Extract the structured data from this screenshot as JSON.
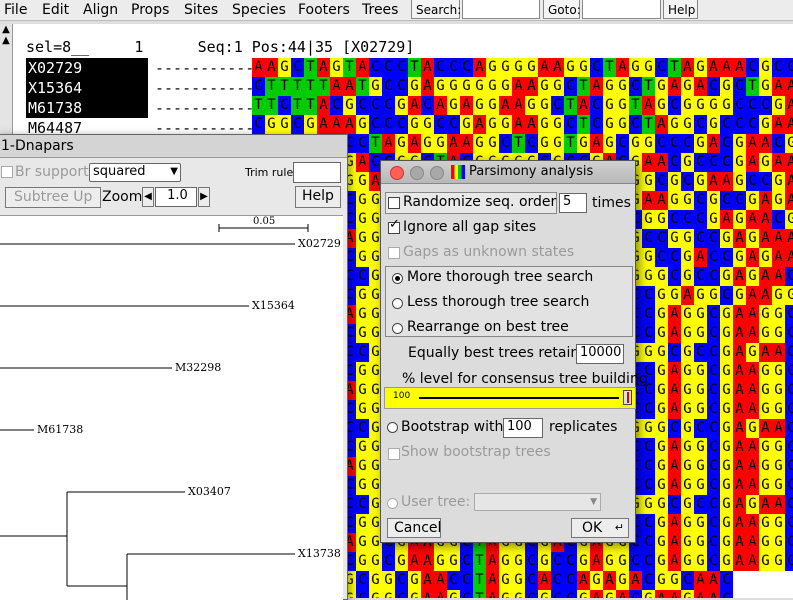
{
  "menubar": {
    "items": [
      "File",
      "Edit",
      "Align",
      "Props",
      "Sites",
      "Species",
      "Footers",
      "Trees"
    ],
    "search_label": "Search:",
    "goto_label": "Goto:",
    "help_label": "Help"
  },
  "alignment": {
    "status_line": "sel=8__     1      Seq:1 Pos:44|35 [X02729]",
    "sequence_names": [
      {
        "name": "X02729",
        "selected": true
      },
      {
        "name": "X15364",
        "selected": true
      },
      {
        "name": "M61738",
        "selected": true
      },
      {
        "name": "M64487",
        "selected": false
      }
    ],
    "gap_prefixes": [
      "-----------",
      "-------------",
      "---------------",
      "---------------"
    ],
    "rows": [
      "AAGCTAGTACCCTACCCAGGGGAAGGCTAGGCTAGAAACGCCGATGAAG",
      "CTTTTTAATGCCGAGGGGGGAAGGCTAGGCTGAGACGCTGAAGAAGCTA",
      "TTCTTACGCCCGACAGAGGAAGGCTACGGTAGCGGGGCCCGACGAACG",
      "CGGCGAAAGCCCGGCCGAGGAAGGCTCGGCTAGGCGCCCGAAAGAAGT",
      "GCTACTGCCTAGAGGAAGGCTCGGTGAGCGGCCCGACGAACGGCTTAC",
      "AAGCTACGACCGGCTACGGGGGCGCCGACGAACGCCCGAGAACGCCGA",
      "CGAGCTTGGAGGAAGGCGAAGGCTACCGAGGCGCGAAGCCGAGAACGGC",
      "CAAGCTACGGCGAAGGCTAGGCGCCGAAAGAAGGCGCCGAGAACGGACG",
      "AAGGCTACGGCGAAGGCTAGGCGCCGAGGCGGCCCGAGAACGAGGCGAA",
      "CGAGCTAAGGCGAAGGCTAGGGGCCCGAGGCCGGCCGAGAAAGGCTACG",
      "AAGGCTACGGCGAAGGCTAGGGCGGCCGAGGCCGACCGAGAACGAGGCC",
      "CGGCTAGCCGAAGGCTAGGCCCGACGAAGGGGCGCCGAGAACGGCGAAG",
      "AAGGCTACGGCGAAGGCTACCGCCGAGGACCGGAGGCGAAGGCAACGGG",
      "CGAGCTAAGGCGAAGGCTAGGCGCCGAGGCCGAGGCGAAGGCAACGGCC",
      "AAGGCTACGGCGAAGGCTAGGCGACGAGGCCGAGGCGAAGGCAACGGCT",
      "CGGCTAGCCGAAGGCTAGGCCCGACGAAGGGGCGCCGAGAACGGCGAAG",
      "AAGGCTACGGCGAAGGCTAGCGGCCGAGGCCGAGGCGAAGGCAACGGAA",
      "CGAGCTAAGGCGAAGGCTAGGCGACGAGGCCGAGGCGAAGGCAACGGCA",
      "AAGGCTACGGCGAAGGCTAGGCGCCGAGGCCGAGGCGAAGGCAACGGCG",
      "CGGCTAGCCGAAGGCTAGGCCCGACGAAGGGGCGCCGAGAACGGCGAAG",
      "AAGGCTACGGCGAAGGCTAGCGGCCGAGGCCGAGGCGAAGGCAACGGCA",
      "CGAGCTAAGGCGAAGGCTAGGCGACGAGGCCGAGGCGAAGGCAACGGCG",
      "AAGGCTACGGCGAAGGCTAGGCGCCGAGGCCGAGGCGAAGGCAACGGCA",
      "CGGCTAGCCGAAGGCTAGGCCCGACGAAGGGGCGCCGAGAACGGCGAAG",
      "AAGGCTACGGCGAAGGCTAGCGGCCGAGGCCGAGGCGAAGGCAACGGCG",
      "CGAGCTAAGGCGAAGGCTAGGCGACGAGGCCGAGGCGAAGGCAACGGCA",
      "AAGGCTACGGCGAAGGCTAGGCGCCGAGGCCGAGGCGAAGGCAACGGCG",
      "AAGGCTTGCGGCGAACCTAGGCACCAGAGACGGCAAC",
      "AAGGCTTGCGGCGAAGCTAGGCGCCGAGACGAAGAAC"
    ]
  },
  "tree_window": {
    "title": "1-Dnapars",
    "br_support_label": "Br support",
    "scale_select": "squared",
    "trim_rule_label": "Trim rule:",
    "subtree_up_label": "Subtree Up",
    "zoom_label": "Zoom",
    "zoom_value": "1.0",
    "help_label": "Help",
    "scale_bar": "0.05",
    "leaves": [
      "X02729",
      "X15364",
      "M32298",
      "M61738",
      "X03407",
      "X13738"
    ]
  },
  "dialog": {
    "title": "Parsimony analysis",
    "randomize_label": "Randomize seq. order",
    "randomize_times": "5",
    "times_label": "times",
    "ignore_gaps_label": "Ignore all gap sites",
    "gaps_unknown_label": "Gaps as unknown states",
    "search_options": [
      "More thorough tree search",
      "Less thorough tree search",
      "Rearrange on best tree"
    ],
    "best_trees_label": "Equally best trees retained",
    "best_trees_value": "10000",
    "consensus_label": "% level for consensus tree building",
    "consensus_value": "100",
    "bootstrap_label": "Bootstrap with",
    "bootstrap_value": "100",
    "replicates_label": "replicates",
    "show_bootstrap_label": "Show bootstrap trees",
    "user_tree_label": "User tree:",
    "cancel_label": "Cancel",
    "ok_label": "OK"
  },
  "colors": {
    "A": "#ff0000",
    "C": "#0000ff",
    "G": "#ffff00",
    "T": "#00cc00",
    "gap": "#ffffff"
  }
}
